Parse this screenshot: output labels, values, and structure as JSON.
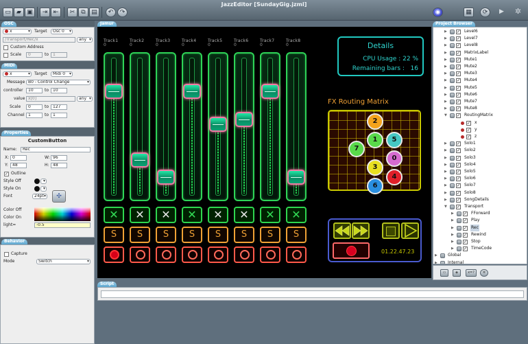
{
  "window": {
    "title": "JazzEditor [SundayGig.jzml]"
  },
  "toolbar": {
    "buttons": [
      "new-file",
      "open-folder",
      "save",
      "import",
      "export",
      "cut",
      "copy",
      "paste",
      "undo",
      "redo"
    ],
    "right_buttons": [
      "globe",
      "screen",
      "sync",
      "play",
      "settings"
    ]
  },
  "osc": {
    "header": "OSC",
    "var_name": "x",
    "target_label": "Target",
    "target_value": "Osc 0",
    "address": "/Transport/Rec/x",
    "any_label": "any",
    "custom_address_label": "Custom Address",
    "scale_label": "Scale",
    "scale_from": "0",
    "to_label": "to",
    "scale_to": "1"
  },
  "midi": {
    "header": "MIDI",
    "var_name": "x",
    "target_label": "Target",
    "target_value": "Midi 0",
    "message_label": "Message",
    "message_value": "B0 - Control Change",
    "controller_label": "controller",
    "controller_from": "10",
    "to_label": "to",
    "controller_to": "10",
    "value_label": "value",
    "value_expr": "x[0]",
    "any_label": "any",
    "scale_label": "Scale",
    "scale_from": "0",
    "scale_to": "127",
    "channel_label": "Channel",
    "channel_from": "1",
    "channel_to": "1"
  },
  "properties": {
    "header": "Properties",
    "object_type": "CustomButton",
    "name_label": "Name:",
    "name_value": "Rec",
    "x_label": "X:",
    "x_value": "0",
    "w_label": "W:",
    "w_value": "96",
    "y_label": "Y:",
    "y_value": "48",
    "h_label": "H:",
    "h_value": "48",
    "outline_label": "Outline",
    "style_off_label": "Style Off",
    "style_on_label": "Style On",
    "font_label": "Font",
    "font_value": "24pt",
    "color_off_label": "Color Off",
    "color_on_label": "Color On",
    "light_label": "light=",
    "light_value": "-0.5"
  },
  "behavior": {
    "header": "Behavior",
    "capture_label": "Capture",
    "mode_label": "Mode",
    "mode_value": "Switch"
  },
  "canvas": {
    "header": "Jamur",
    "tracks": [
      {
        "label": "Track1",
        "value": "0",
        "level": 0.79,
        "mute_on": true,
        "solo": "S",
        "rec_filled": true
      },
      {
        "label": "Track2",
        "value": "0",
        "level": 0.23,
        "mute_on": false,
        "solo": "S",
        "rec_filled": false
      },
      {
        "label": "Track3",
        "value": "0",
        "level": 0.09,
        "mute_on": false,
        "solo": "S",
        "rec_filled": false
      },
      {
        "label": "Track4",
        "value": "0",
        "level": 0.79,
        "mute_on": true,
        "solo": "S",
        "rec_filled": false
      },
      {
        "label": "Track5",
        "value": "0",
        "level": 0.52,
        "mute_on": false,
        "solo": "S",
        "rec_filled": false
      },
      {
        "label": "Track6",
        "value": "0",
        "level": 0.56,
        "mute_on": false,
        "solo": "S",
        "rec_filled": false
      },
      {
        "label": "Track7",
        "value": "0",
        "level": 0.79,
        "mute_on": true,
        "solo": "S",
        "rec_filled": false
      },
      {
        "label": "Track8",
        "value": "0",
        "level": 0.09,
        "mute_on": true,
        "solo": "S",
        "rec_filled": false
      }
    ],
    "details": {
      "title": "Details",
      "cpu_label": "CPU Usage :",
      "cpu_value": "22 %",
      "bars_label": "Remaining bars :",
      "bars_value": "16"
    },
    "fx": {
      "title": "FX Routing Matrix",
      "nodes": [
        {
          "label": "2",
          "color": "#f5a31c"
        },
        {
          "label": "1",
          "color": "#59d94a"
        },
        {
          "label": "5",
          "color": "#46c7c4"
        },
        {
          "label": "7",
          "color": "#59d94a"
        },
        {
          "label": "0",
          "color": "#d66ad0"
        },
        {
          "label": "3",
          "color": "#e8e020"
        },
        {
          "label": "4",
          "color": "#e0202a"
        },
        {
          "label": "6",
          "color": "#2a8fe0"
        }
      ]
    },
    "transport": {
      "timecode": "01.22.47.23"
    }
  },
  "browser": {
    "header": "Project Browser",
    "items": [
      {
        "label": "Level6",
        "type": "obj"
      },
      {
        "label": "Level7",
        "type": "obj"
      },
      {
        "label": "Level8",
        "type": "obj"
      },
      {
        "label": "MatrixLabel",
        "type": "obj"
      },
      {
        "label": "Mute1",
        "type": "obj"
      },
      {
        "label": "Mute2",
        "type": "obj"
      },
      {
        "label": "Mute3",
        "type": "obj"
      },
      {
        "label": "Mute4",
        "type": "obj"
      },
      {
        "label": "Mute5",
        "type": "obj"
      },
      {
        "label": "Mute6",
        "type": "obj"
      },
      {
        "label": "Mute7",
        "type": "obj"
      },
      {
        "label": "Mute8",
        "type": "obj"
      },
      {
        "label": "RoutingMatrix",
        "type": "open"
      },
      {
        "label": "x",
        "type": "var"
      },
      {
        "label": "y",
        "type": "var"
      },
      {
        "label": "z",
        "type": "var"
      },
      {
        "label": "Solo1",
        "type": "obj"
      },
      {
        "label": "Solo2",
        "type": "obj"
      },
      {
        "label": "Solo3",
        "type": "obj"
      },
      {
        "label": "Solo4",
        "type": "obj"
      },
      {
        "label": "Solo5",
        "type": "obj"
      },
      {
        "label": "Solo6",
        "type": "obj"
      },
      {
        "label": "Solo7",
        "type": "obj"
      },
      {
        "label": "Solo8",
        "type": "obj"
      },
      {
        "label": "SongDetails",
        "type": "obj"
      },
      {
        "label": "Transport",
        "type": "open"
      },
      {
        "label": "FForward",
        "type": "child"
      },
      {
        "label": "Play",
        "type": "child"
      },
      {
        "label": "Rec",
        "type": "child",
        "selected": true
      },
      {
        "label": "Rewind",
        "type": "child"
      },
      {
        "label": "Stop",
        "type": "child"
      },
      {
        "label": "TimeCode",
        "type": "child"
      },
      {
        "label": "Global",
        "type": "root"
      },
      {
        "label": "Internal",
        "type": "root"
      }
    ],
    "footer_icons": [
      "folder",
      "cube",
      "variable",
      "gear"
    ],
    "variable_icon_text": "x=?"
  },
  "script": {
    "header": "Script"
  }
}
